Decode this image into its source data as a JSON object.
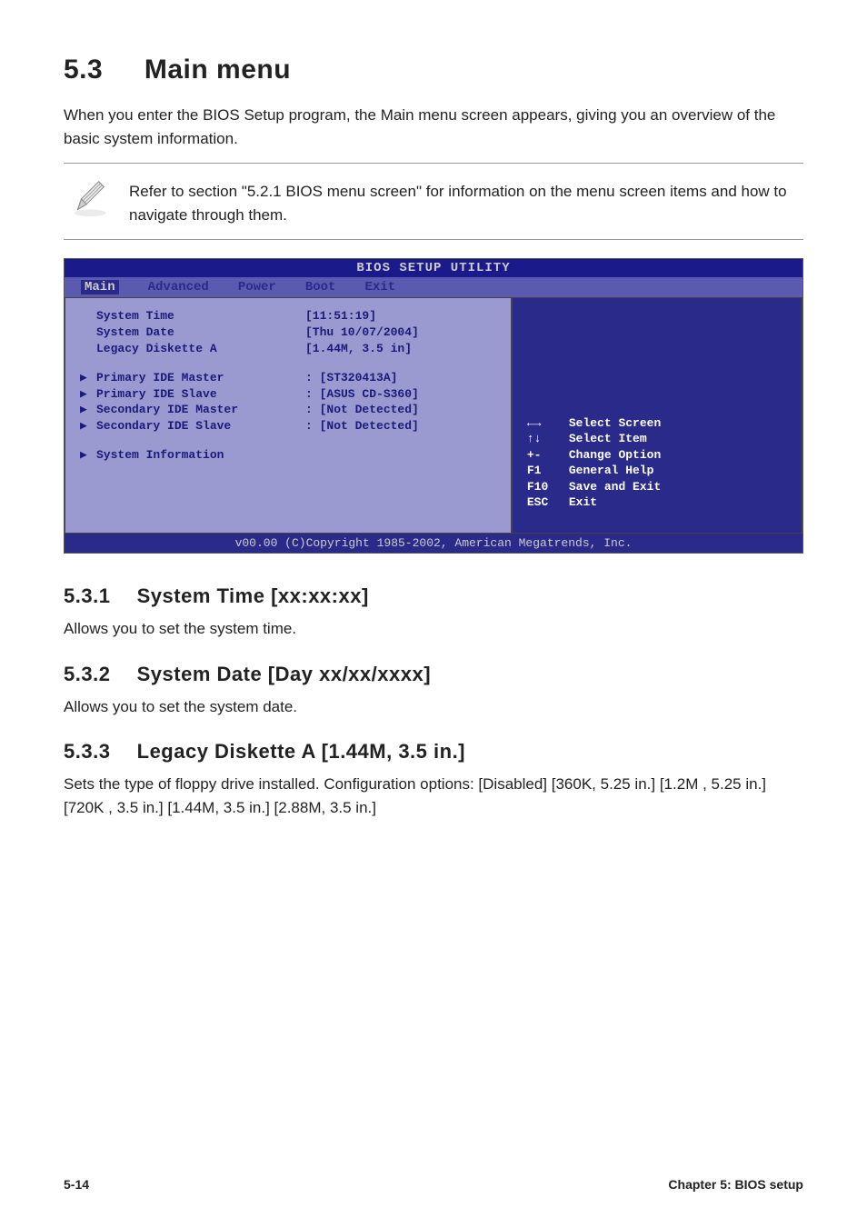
{
  "title": {
    "number": "5.3",
    "text": "Main menu"
  },
  "intro": "When you enter the BIOS Setup program, the Main menu screen appears, giving you an overview of the basic system information.",
  "note": "Refer to section \"5.2.1  BIOS menu screen\" for information on the menu screen items and how to navigate through them.",
  "bios": {
    "titlebar": "BIOS SETUP UTILITY",
    "menus": [
      "Main",
      "Advanced",
      "Power",
      "Boot",
      "Exit"
    ],
    "rows": [
      {
        "arrow": "",
        "label": "System Time",
        "value": "[11:51:19]"
      },
      {
        "arrow": "",
        "label": "System Date",
        "value": "[Thu 10/07/2004]"
      },
      {
        "arrow": "",
        "label": "Legacy Diskette A",
        "value": "[1.44M, 3.5 in]"
      }
    ],
    "rows2": [
      {
        "arrow": "▶",
        "label": "Primary IDE Master",
        "value": ": [ST320413A]"
      },
      {
        "arrow": "▶",
        "label": "Primary IDE Slave",
        "value": ": [ASUS CD-S360]"
      },
      {
        "arrow": "▶",
        "label": "Secondary IDE Master",
        "value": ": [Not Detected]"
      },
      {
        "arrow": "▶",
        "label": "Secondary IDE Slave",
        "value": ": [Not Detected]"
      }
    ],
    "rows3": [
      {
        "arrow": "▶",
        "label": "System Information",
        "value": ""
      }
    ],
    "help": [
      {
        "key": "←→",
        "text": "Select Screen"
      },
      {
        "key": "↑↓",
        "text": "Select Item"
      },
      {
        "key": "+-",
        "text": "Change Option"
      },
      {
        "key": "F1",
        "text": "General Help"
      },
      {
        "key": "F10",
        "text": "Save and Exit"
      },
      {
        "key": "ESC",
        "text": "Exit"
      }
    ],
    "footer": "v00.00 (C)Copyright 1985-2002, American Megatrends, Inc."
  },
  "subsections": [
    {
      "num": "5.3.1",
      "title": "System Time [xx:xx:xx]",
      "body": "Allows you to set the system time."
    },
    {
      "num": "5.3.2",
      "title": "System Date [Day xx/xx/xxxx]",
      "body": "Allows you to set the system date."
    },
    {
      "num": "5.3.3",
      "title": "Legacy Diskette A [1.44M, 3.5 in.]",
      "body": "Sets the type of floppy drive installed. Configuration options: [Disabled] [360K, 5.25 in.] [1.2M , 5.25 in.] [720K , 3.5 in.] [1.44M, 3.5 in.] [2.88M, 3.5 in.]"
    }
  ],
  "footer": {
    "left": "5-14",
    "right": "Chapter 5: BIOS setup"
  }
}
